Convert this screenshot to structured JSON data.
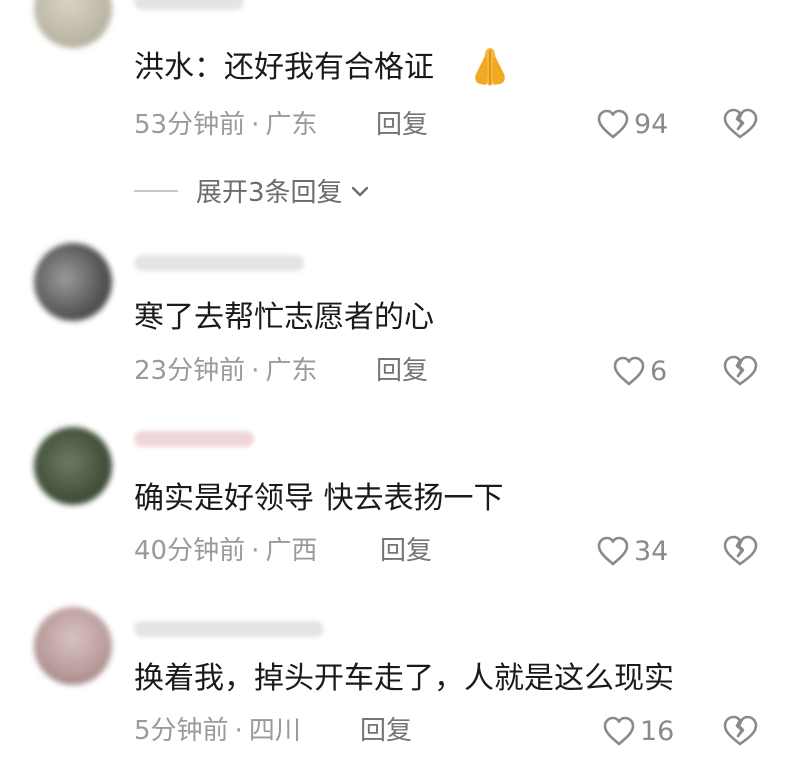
{
  "comments": [
    {
      "author": "洪水",
      "text": "洪水：还好我有合格证",
      "time": "53分钟前",
      "location": "广东",
      "likes": "94",
      "emoji": "folded-hands"
    },
    {
      "author": "",
      "text": "寒了去帮忙志愿者的心",
      "time": "23分钟前",
      "location": "广东",
      "likes": "6"
    },
    {
      "author": "",
      "text": "确实是好领导  快去表扬一下",
      "time": "40分钟前",
      "location": "广西",
      "likes": "34"
    },
    {
      "author": "",
      "text": "换着我，掉头开车走了，人就是这么现实",
      "time": "5分钟前",
      "location": "四川",
      "likes": "16"
    }
  ],
  "reply_label": "回复",
  "separator": "·",
  "expand_replies_label": "展开3条回复",
  "colors": {
    "text": "#1a1a1a",
    "meta": "#9a9a9e",
    "icon": "#8a8a8e"
  }
}
